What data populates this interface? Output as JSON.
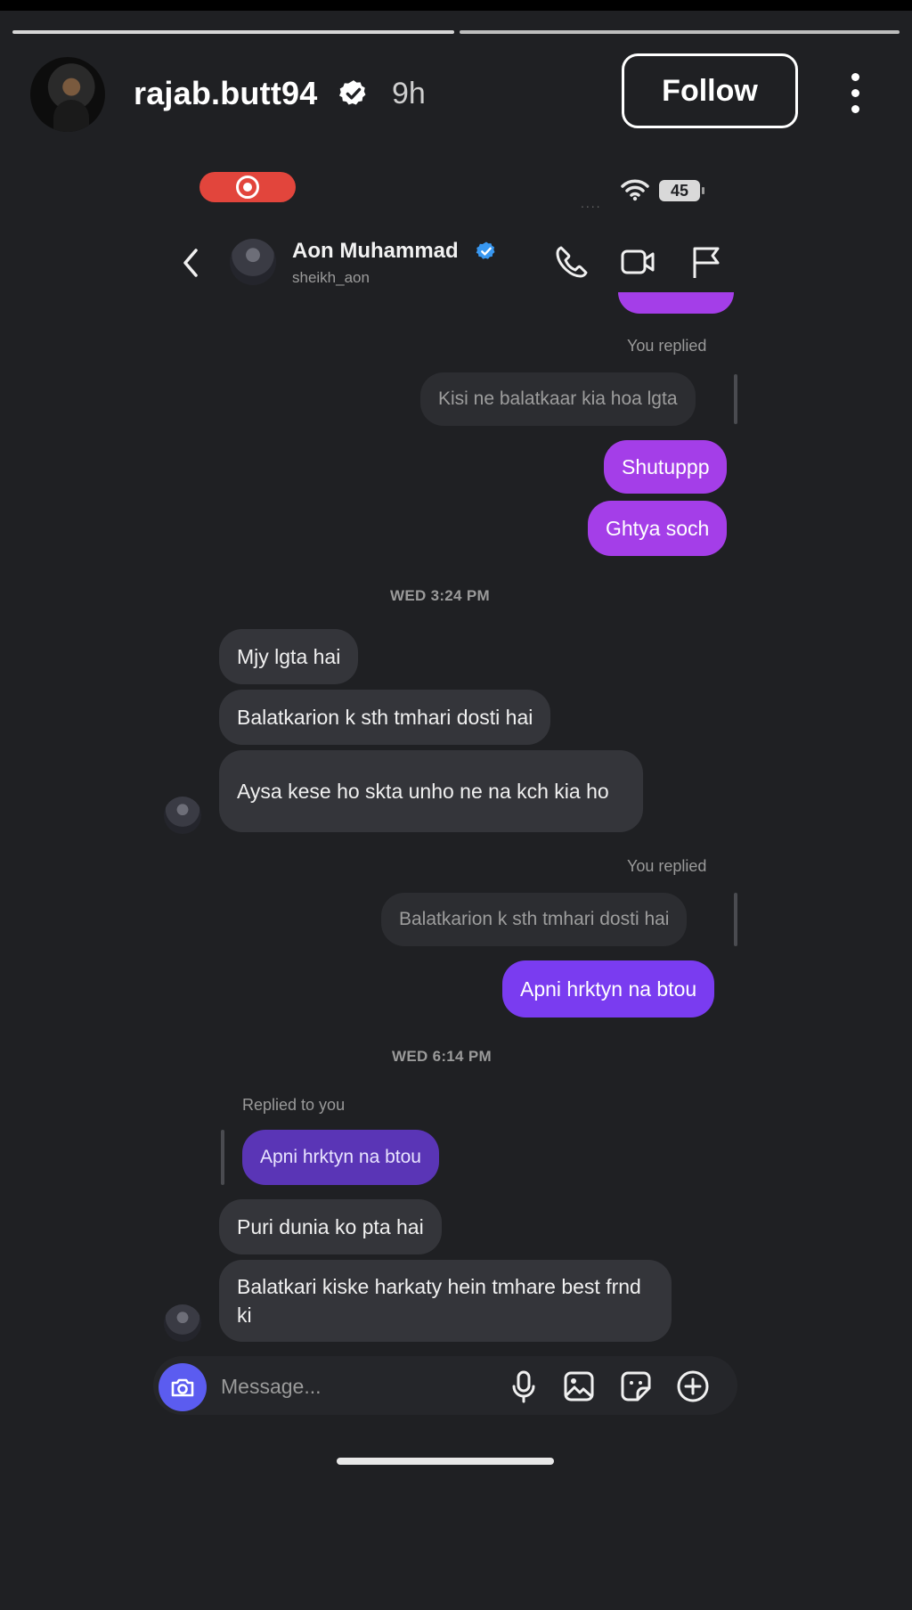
{
  "story": {
    "username": "rajab.butt94",
    "time": "9h",
    "follow_label": "Follow",
    "icons": [
      "verified-badge-icon",
      "more-options-icon"
    ]
  },
  "inner_status": {
    "battery": "45",
    "signal": "....",
    "icons": [
      "screen-record-icon",
      "wifi-icon",
      "battery-icon"
    ]
  },
  "chat_header": {
    "name": "Aon Muhammad",
    "handle": "sheikh_aon",
    "icons": [
      "back-chevron-icon",
      "call-icon",
      "video-icon",
      "flag-icon"
    ]
  },
  "messages": {
    "you_replied_1": "You replied",
    "quote_1": "Kisi ne balatkaar kia hoa lgta",
    "out_1": "Shutuppp",
    "out_2": "Ghtya soch",
    "timestamp_1": "WED 3:24 PM",
    "in_1": "Mjy lgta hai",
    "in_2": "Balatkarion k sth tmhari dosti hai",
    "in_3": "Aysa kese ho skta unho ne na kch kia ho",
    "you_replied_2": "You replied",
    "quote_2": "Balatkarion k sth tmhari dosti hai",
    "out_3": "Apni hrktyn na btou",
    "timestamp_2": "WED 6:14 PM",
    "replied_to_you": "Replied to you",
    "quote_3": "Apni hrktyn na btou",
    "in_4": "Puri dunia ko pta hai",
    "in_5": "Balatkari kiske harkaty hein tmhare best frnd ki"
  },
  "composer": {
    "placeholder": "Message...",
    "icons": [
      "camera-icon",
      "mic-icon",
      "gallery-icon",
      "sticker-icon",
      "plus-icon"
    ]
  },
  "colors": {
    "background": "#1f2023",
    "incoming_bubble": "#34353a",
    "outgoing_purple": "#a43ee8",
    "outgoing_violet": "#7a3cf0",
    "verified_blue": "#3897f0",
    "record_red": "#e2453c"
  }
}
